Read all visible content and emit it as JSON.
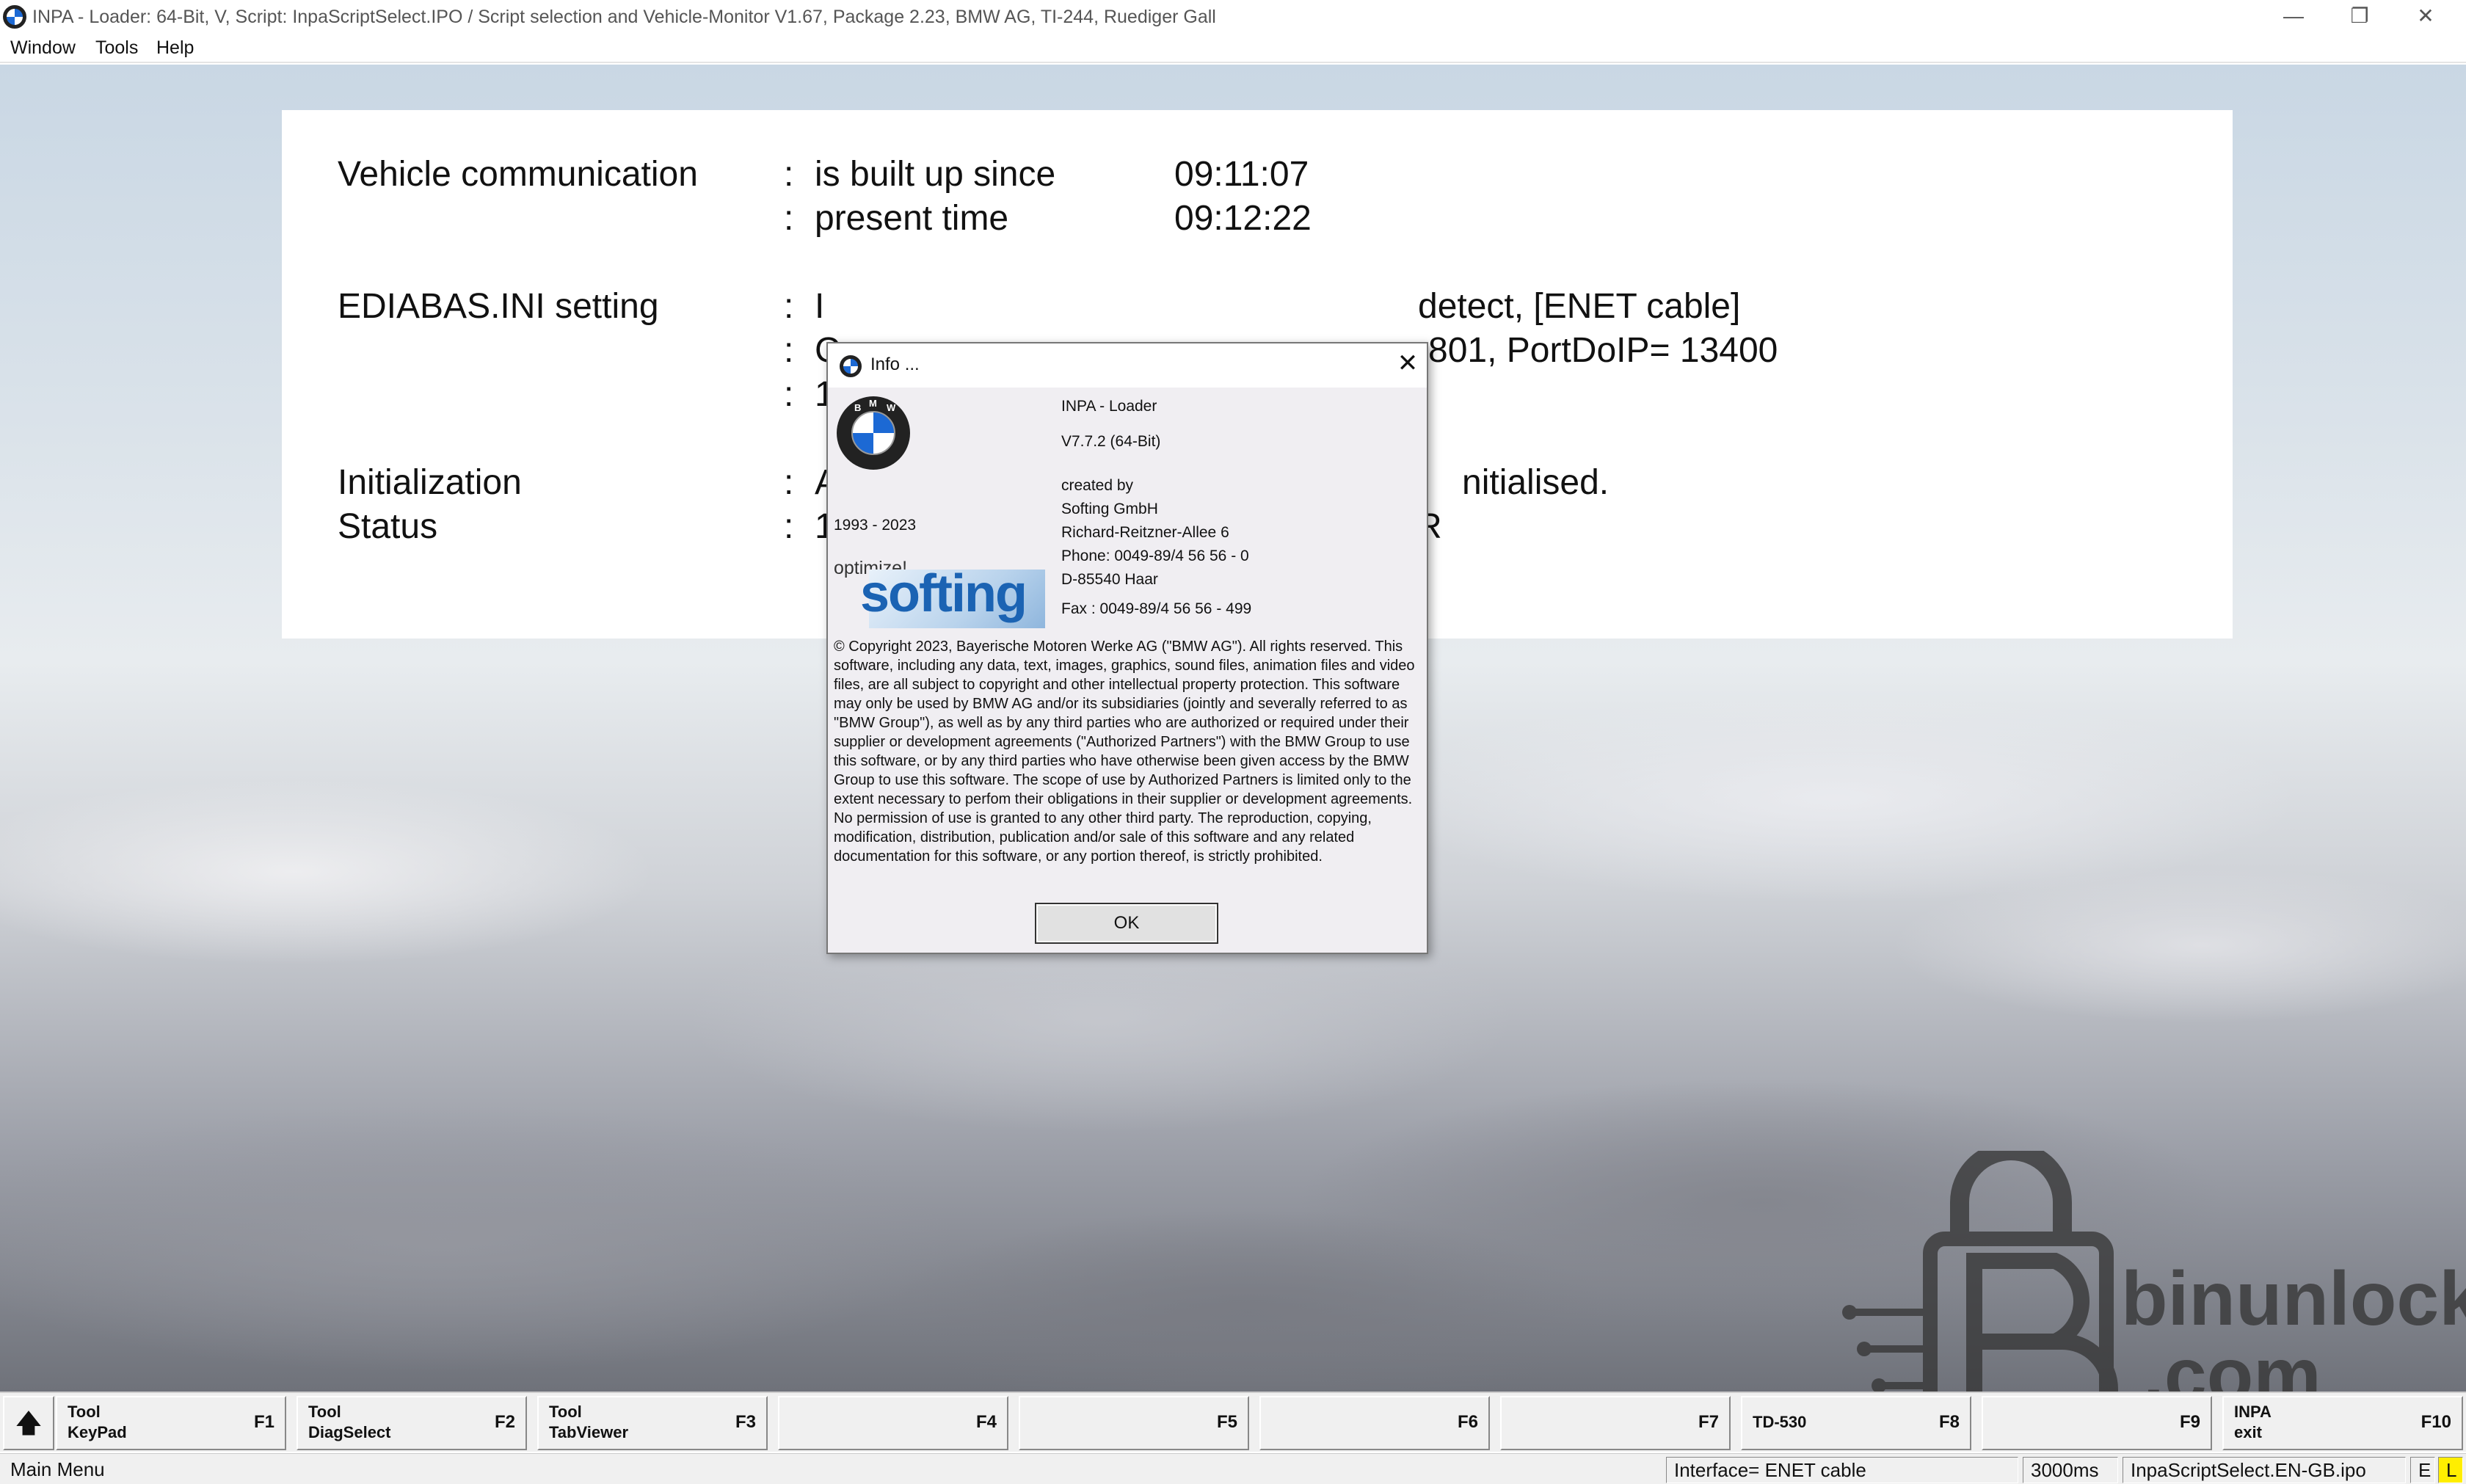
{
  "window": {
    "title": "INPA - Loader:  64-Bit, V, Script: InpaScriptSelect.IPO / Script selection and Vehicle-Monitor V1.67, Package 2.23, BMW AG, TI-244, Ruediger Gall",
    "minimize": "—",
    "restore": "❐",
    "close": "✕"
  },
  "menu": [
    "Window",
    "Tools",
    "Help"
  ],
  "panel": {
    "rows": [
      {
        "label": "Vehicle communication",
        "sep": ":",
        "text": "is built up since",
        "value": "09:11:07"
      },
      {
        "label": "",
        "sep": ":",
        "text": "present time",
        "value": "09:12:22"
      }
    ],
    "ediabas_label": "EDIABAS.INI setting",
    "ediabas_lines": [
      {
        "sep": ":",
        "left": "I",
        "right": "detect, [ENET cable]"
      },
      {
        "sep": ":",
        "left": "C",
        "right": "801, PortDoIP= 13400"
      },
      {
        "sep": ":",
        "left": "1",
        "right": ""
      }
    ],
    "init_label": "Initialization",
    "init_sep": ":",
    "init_left": "A",
    "init_right": "nitialised.",
    "status_label": "Status",
    "status_sep": ":",
    "status_left": "1",
    "status_right": "R"
  },
  "dialog": {
    "caption": "Info ...",
    "close": "✕",
    "product": "INPA - Loader",
    "version": "V7.7.2   (64-Bit)",
    "years": "1993 - 2023",
    "created_by": "created by",
    "company": "Softing GmbH",
    "street": "Richard-Reitzner-Allee 6",
    "phone": "Phone: 0049-89/4 56 56 - 0",
    "city": "D-85540 Haar",
    "fax": "Fax  : 0049-89/4 56 56 - 499",
    "optimize": "optimize!",
    "softing": "softing",
    "copyright": "© Copyright 2023, Bayerische Motoren Werke AG (\"BMW AG\"). All rights reserved. This software, including any data, text, images, graphics, sound files, animation files and video files, are all subject to copyright and other intellectual property protection. This software may only be used by BMW AG and/or its subsidiaries (jointly and severally referred to as \"BMW Group\"), as well as by any third parties who are authorized or required under their supplier or development agreements (\"Authorized Partners\") with the BMW Group to use this software, or by any third parties who have otherwise been given access by the BMW Group to use this software. The scope of use by Authorized Partners is limited only to the extent necessary to perfom their obligations in their supplier or development agreements.  No permission of use is granted to any other third party. The reproduction, copying, modification, distribution, publication and/or sale of this software and any related documentation for this software, or any portion thereof, is strictly prohibited.",
    "ok": "OK"
  },
  "watermark": {
    "text1": "binunlock",
    "text2": ".com"
  },
  "fkeys": [
    {
      "label": "Tool\nKeyPad",
      "key": "F1"
    },
    {
      "label": "Tool\nDiagSelect",
      "key": "F2"
    },
    {
      "label": "Tool\nTabViewer",
      "key": "F3"
    },
    {
      "label": "",
      "key": "F4"
    },
    {
      "label": "",
      "key": "F5"
    },
    {
      "label": "",
      "key": "F6"
    },
    {
      "label": "",
      "key": "F7"
    },
    {
      "label": "TD-530",
      "key": "F8"
    },
    {
      "label": "",
      "key": "F9"
    },
    {
      "label": "INPA\nexit",
      "key": "F10"
    }
  ],
  "up_arrow": "🡅",
  "status": {
    "mode": "Main Menu",
    "interface": "Interface= ENET cable",
    "timing": "3000ms",
    "script": "InpaScriptSelect.EN-GB.ipo",
    "e": "E",
    "l": "L"
  }
}
